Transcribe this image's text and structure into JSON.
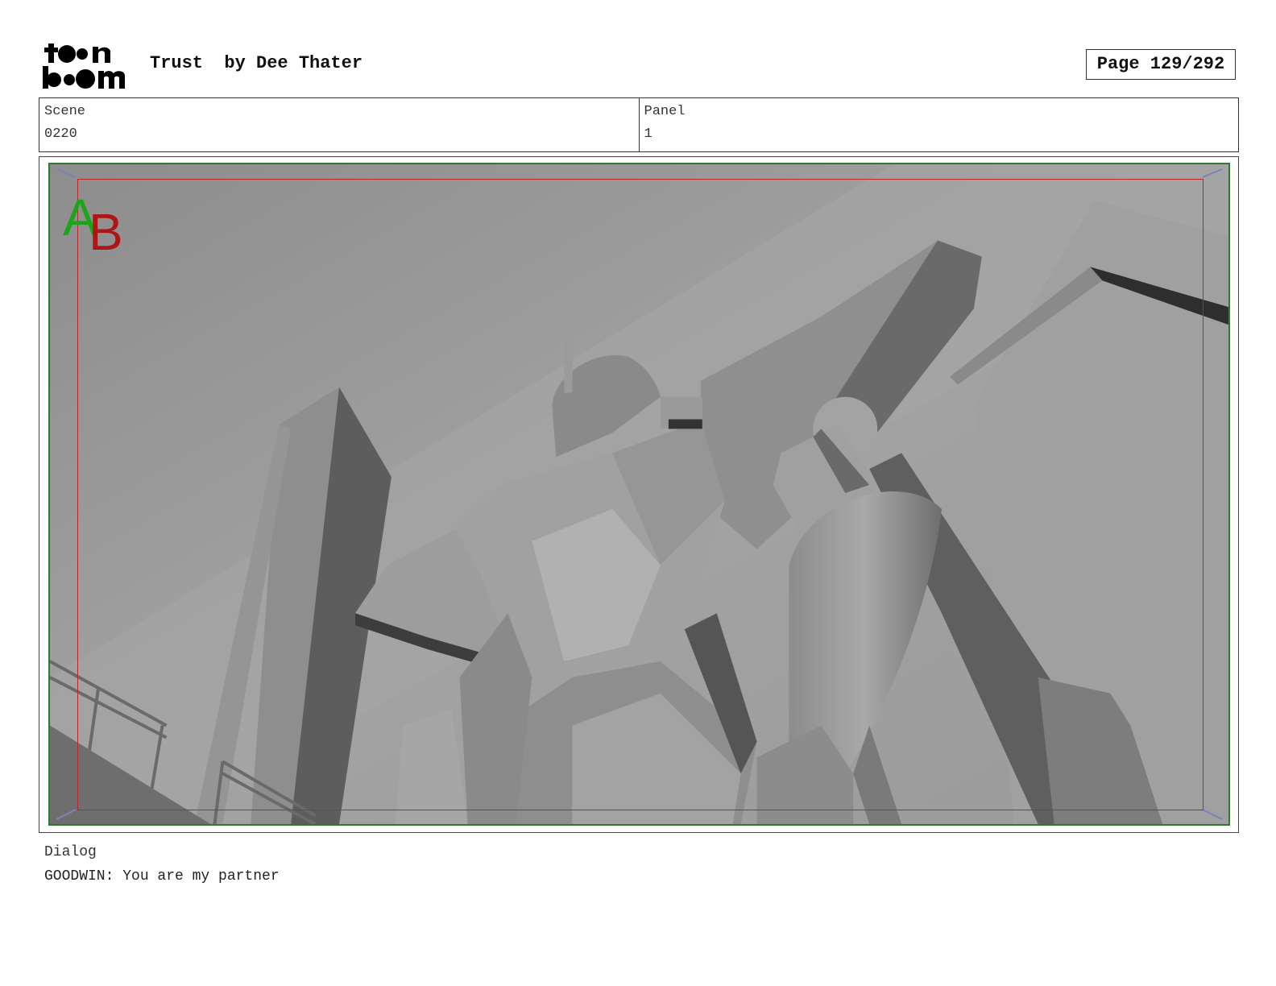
{
  "header": {
    "logo_text": "toon boom",
    "title": "Trust  by Dee Thater",
    "page": "Page 129/292"
  },
  "info": {
    "scene_label": "Scene",
    "scene_value": "0220",
    "panel_label": "Panel",
    "panel_value": "1"
  },
  "frame": {
    "border_color": "#2f7a33",
    "safe_area_color": "#c0232a",
    "ab_marker": {
      "a": "A",
      "b": "B",
      "a_color": "#1aa51a",
      "b_color": "#b01515"
    }
  },
  "dialog": {
    "label": "Dialog",
    "text": "GOODWIN: You are my partner"
  }
}
